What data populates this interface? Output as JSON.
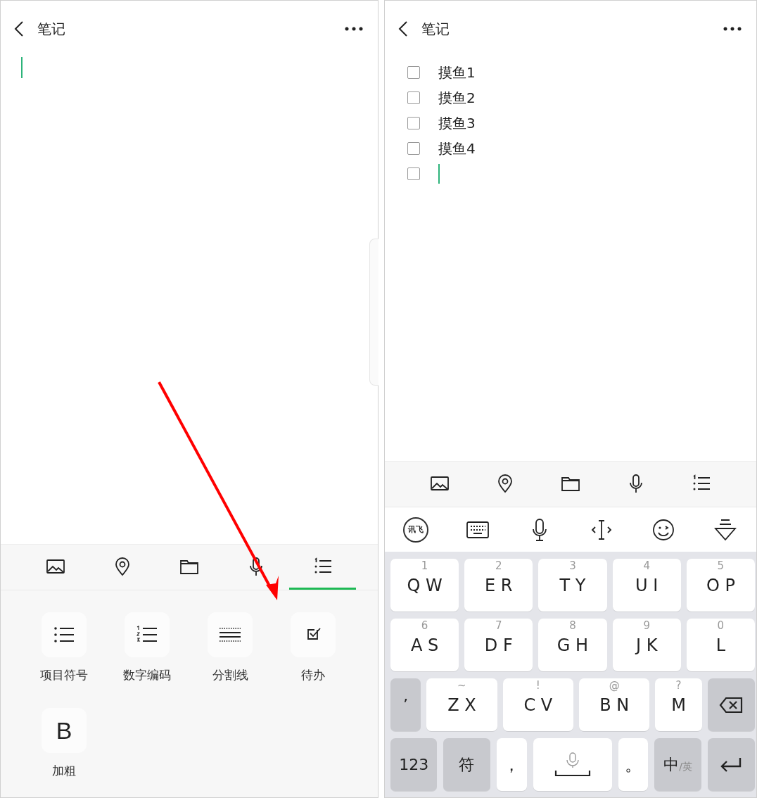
{
  "screens": [
    {
      "header": {
        "title": "笔记"
      },
      "editor": {
        "kind": "text",
        "cursor": true
      },
      "toolbar": [
        {
          "kind": "image",
          "selected": false
        },
        {
          "kind": "location",
          "selected": false
        },
        {
          "kind": "folder",
          "selected": false
        },
        {
          "kind": "mic",
          "selected": false
        },
        {
          "kind": "list",
          "selected": true
        }
      ],
      "format_panel": [
        {
          "kind": "bullets",
          "label": "项目符号"
        },
        {
          "kind": "numbers",
          "label": "数字编码"
        },
        {
          "kind": "divider",
          "label": "分割线"
        },
        {
          "kind": "todo",
          "label": "待办"
        },
        {
          "kind": "bold",
          "glyph": "B",
          "label": "加粗"
        }
      ]
    },
    {
      "header": {
        "title": "笔记"
      },
      "editor": {
        "kind": "todo",
        "items": [
          {
            "text": "摸鱼1",
            "checked": false,
            "cursor": false
          },
          {
            "text": "摸鱼2",
            "checked": false,
            "cursor": false
          },
          {
            "text": "摸鱼3",
            "checked": false,
            "cursor": false
          },
          {
            "text": "摸鱼4",
            "checked": false,
            "cursor": false
          },
          {
            "checked": false,
            "cursor": true
          }
        ]
      },
      "toolbar": [
        {
          "kind": "image",
          "selected": false
        },
        {
          "kind": "location",
          "selected": false
        },
        {
          "kind": "folder",
          "selected": false
        },
        {
          "kind": "mic",
          "selected": false
        },
        {
          "kind": "list",
          "selected": false
        }
      ],
      "keyboard": {
        "toolbar": [
          {
            "kind": "ime-logo",
            "text": "讯飞"
          },
          {
            "kind": "keyboard"
          },
          {
            "kind": "mic"
          },
          {
            "kind": "cursor"
          },
          {
            "kind": "emoji"
          },
          {
            "kind": "hide"
          }
        ],
        "rows": [
          {
            "keys": [
              {
                "kind": "letter",
                "label": "Q W",
                "hint": "1"
              },
              {
                "kind": "letter",
                "label": "E R",
                "hint": "2"
              },
              {
                "kind": "letter",
                "label": "T Y",
                "hint": "3"
              },
              {
                "kind": "letter",
                "label": "U I",
                "hint": "4"
              },
              {
                "kind": "letter",
                "label": "O P",
                "hint": "5"
              }
            ]
          },
          {
            "keys": [
              {
                "kind": "letter",
                "label": "A S",
                "hint": "6"
              },
              {
                "kind": "letter",
                "label": "D F",
                "hint": "7"
              },
              {
                "kind": "letter",
                "label": "G H",
                "hint": "8"
              },
              {
                "kind": "letter",
                "label": "J K",
                "hint": "9"
              },
              {
                "kind": "letter",
                "label": "L",
                "hint": "0"
              }
            ]
          },
          {
            "keys": [
              {
                "kind": "function",
                "label": "’"
              },
              {
                "kind": "letter",
                "label": "Z X",
                "hint": "~"
              },
              {
                "kind": "letter",
                "label": "C V",
                "hint": "!"
              },
              {
                "kind": "letter",
                "label": "B N",
                "hint": "@"
              },
              {
                "kind": "letter",
                "label": "M",
                "hint": "?"
              },
              {
                "kind": "backspace"
              }
            ]
          },
          {
            "keys": [
              {
                "kind": "function",
                "label": "123"
              },
              {
                "kind": "function",
                "label": "符"
              },
              {
                "kind": "letter",
                "label": "，"
              },
              {
                "kind": "space"
              },
              {
                "kind": "letter",
                "label": "。"
              },
              {
                "kind": "lang",
                "label": "中",
                "sub": "/英"
              },
              {
                "kind": "enter"
              }
            ]
          }
        ]
      }
    }
  ],
  "annotations": [
    {
      "kind": "arrow"
    }
  ]
}
